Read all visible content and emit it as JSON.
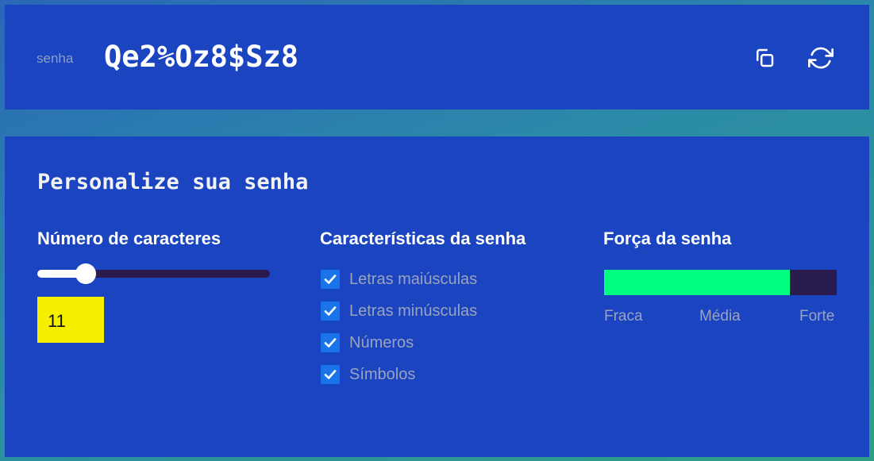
{
  "password": {
    "label": "senha",
    "value": "Qe2%Oz8$Sz8"
  },
  "icons": {
    "copy": "copy-icon",
    "refresh": "refresh-icon",
    "check": "checkmark-icon"
  },
  "settings": {
    "title": "Personalize sua senha",
    "length": {
      "title": "Número de caracteres",
      "value": "11",
      "slider_fraction": 0.18
    },
    "features": {
      "title": "Características da senha",
      "options": [
        {
          "label": "Letras maiúsculas",
          "checked": true
        },
        {
          "label": "Letras minúsculas",
          "checked": true
        },
        {
          "label": "Números",
          "checked": true
        },
        {
          "label": "Símbolos",
          "checked": true
        }
      ]
    },
    "strength": {
      "title": "Força da senha",
      "level_fraction": 0.8,
      "labels": [
        "Fraca",
        "Média",
        "Forte"
      ]
    }
  },
  "colors": {
    "panel": "#1b44c1",
    "slider_track": "#2a1b4e",
    "strength_fill": "#00ff80",
    "length_box": "#f5f000",
    "checkbox": "#1a73e8"
  }
}
